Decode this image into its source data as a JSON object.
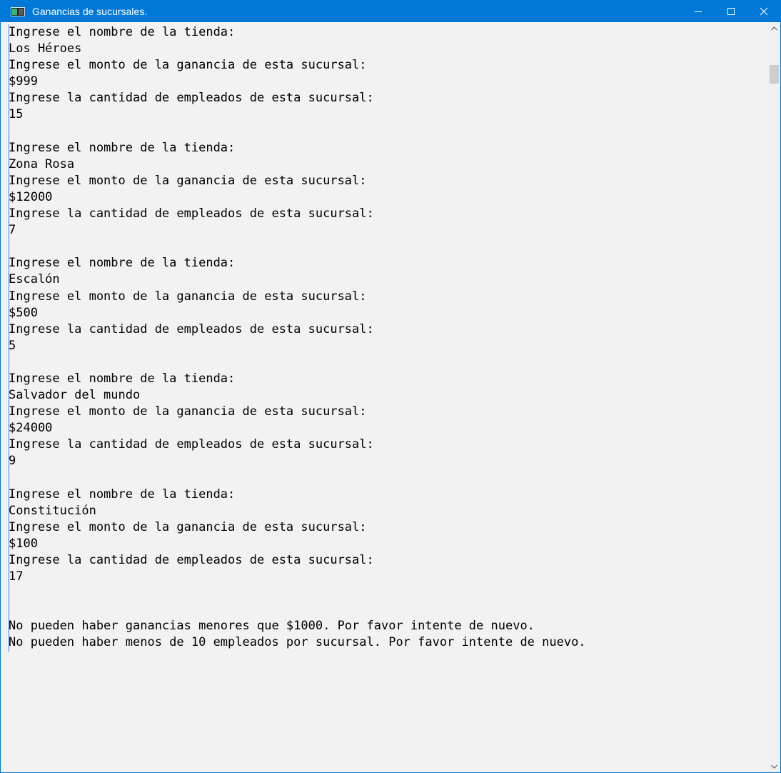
{
  "window": {
    "title": "Ganancias de sucursales.",
    "icon": "console-app-icon"
  },
  "console": {
    "lines": [
      "Ingrese el nombre de la tienda:",
      "Los Héroes",
      "Ingrese el monto de la ganancia de esta sucursal:",
      "$999",
      "Ingrese la cantidad de empleados de esta sucursal:",
      "15",
      "",
      "Ingrese el nombre de la tienda:",
      "Zona Rosa",
      "Ingrese el monto de la ganancia de esta sucursal:",
      "$12000",
      "Ingrese la cantidad de empleados de esta sucursal:",
      "7",
      "",
      "Ingrese el nombre de la tienda:",
      "Escalón",
      "Ingrese el monto de la ganancia de esta sucursal:",
      "$500",
      "Ingrese la cantidad de empleados de esta sucursal:",
      "5",
      "",
      "Ingrese el nombre de la tienda:",
      "Salvador del mundo",
      "Ingrese el monto de la ganancia de esta sucursal:",
      "$24000",
      "Ingrese la cantidad de empleados de esta sucursal:",
      "9",
      "",
      "Ingrese el nombre de la tienda:",
      "Constitución",
      "Ingrese el monto de la ganancia de esta sucursal:",
      "$100",
      "Ingrese la cantidad de empleados de esta sucursal:",
      "17",
      "",
      "",
      "No pueden haber ganancias menores que $1000. Por favor intente de nuevo.",
      "No pueden haber menos de 10 empleados por sucursal. Por favor intente de nuevo."
    ]
  },
  "colors": {
    "titlebar": "#0078d7",
    "console_bg": "#f2f2f2",
    "text": "#000000"
  }
}
